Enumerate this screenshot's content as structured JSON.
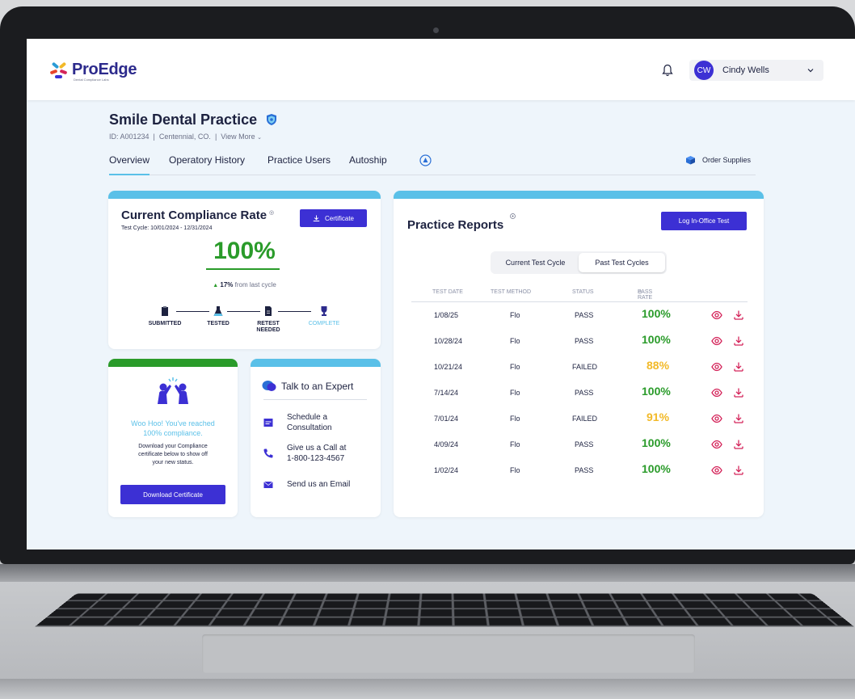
{
  "colors": {
    "primary": "#3c30d4",
    "accent_blue": "#5ac0e8",
    "pass_green": "#2a9b2a",
    "warn_yellow": "#f2b928",
    "icon_pink": "#d4245a",
    "text_dark": "#1d2240"
  },
  "header": {
    "logo_text": "ProEdge",
    "logo_subtext": "Dental Compliance Labs",
    "user_initials": "CW",
    "user_name": "Cindy Wells",
    "icons": [
      "bell-icon",
      "chevron-down-icon"
    ]
  },
  "practice": {
    "name": "Smile Dental Practice",
    "id": "ID: A001234",
    "location": "Centennial, CO.",
    "view_more": "View More",
    "separator": "|"
  },
  "tabs": [
    {
      "label": "Overview",
      "active": true
    },
    {
      "label": "Operatory History",
      "active": false
    },
    {
      "label": "Practice Users",
      "active": false
    },
    {
      "label": "Autoship",
      "active": false
    }
  ],
  "order_supplies_label": "Order Supplies",
  "compliance": {
    "title": "Current Compliance Rate",
    "cycle": "Test Cycle: 10/01/2024 - 12/31/2024",
    "certificate_button": "Certificate",
    "rate": "100%",
    "delta_value": "17%",
    "delta_text": "from last cycle",
    "steps": [
      {
        "label": "SUBMITTED"
      },
      {
        "label": "TESTED"
      },
      {
        "label_line1": "RETEST",
        "label_line2": "NEEDED"
      },
      {
        "label": "COMPLETE"
      }
    ]
  },
  "congrats": {
    "headline_line1": "Woo Hoo! You've reached",
    "headline_line2": "100% compliance.",
    "body_line1": "Download your Compliance",
    "body_line2": "certificate below to show off",
    "body_line3": "your new status.",
    "button": "Download Certificate"
  },
  "expert": {
    "title": "Talk to an Expert",
    "items": [
      {
        "line1": "Schedule a",
        "line2": "Consultation",
        "icon": "calendar-icon"
      },
      {
        "line1": "Give us a Call at",
        "line2": "1-800-123-4567",
        "icon": "phone-icon"
      },
      {
        "line1": "Send us an Email",
        "line2": "",
        "icon": "envelope-icon"
      }
    ]
  },
  "reports": {
    "title": "Practice Reports",
    "log_button": "Log In-Office Test",
    "toggle": [
      "Current Test Cycle",
      "Past Test Cycles"
    ],
    "active_toggle": 1,
    "columns": [
      "TEST DATE",
      "TEST METHOD",
      "STATUS",
      "PASS RATE"
    ],
    "rows": [
      {
        "date": "1/08/25",
        "method": "Flo",
        "status": "PASS",
        "rate": "100%",
        "rate_color": "#2a9b2a"
      },
      {
        "date": "10/28/24",
        "method": "Flo",
        "status": "PASS",
        "rate": "100%",
        "rate_color": "#2a9b2a"
      },
      {
        "date": "10/21/24",
        "method": "Flo",
        "status": "FAILED",
        "rate": "88%",
        "rate_color": "#f2b928"
      },
      {
        "date": "7/14/24",
        "method": "Flo",
        "status": "PASS",
        "rate": "100%",
        "rate_color": "#2a9b2a"
      },
      {
        "date": "7/01/24",
        "method": "Flo",
        "status": "FAILED",
        "rate": "91%",
        "rate_color": "#f2b928"
      },
      {
        "date": "4/09/24",
        "method": "Flo",
        "status": "PASS",
        "rate": "100%",
        "rate_color": "#2a9b2a"
      },
      {
        "date": "1/02/24",
        "method": "Flo",
        "status": "PASS",
        "rate": "100%",
        "rate_color": "#2a9b2a"
      }
    ]
  }
}
